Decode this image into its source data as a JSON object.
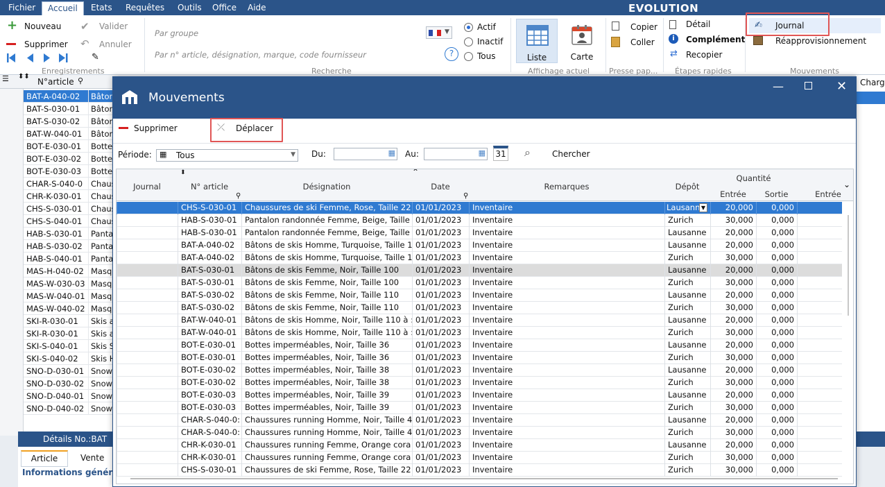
{
  "menubar": {
    "items": [
      "Fichier",
      "Accueil",
      "Etats",
      "Requêtes",
      "Outils",
      "Office",
      "Aide"
    ],
    "app_title": "EVOLUTION"
  },
  "ribbon": {
    "nouveau": "Nouveau",
    "supprimer": "Supprimer",
    "valider": "Valider",
    "annuler": "Annuler",
    "group_enregistrements": "Enregistrements",
    "search_group_placeholder": "Par groupe",
    "search_article_placeholder": "Par n° article, désignation,  marque, code fournisseur",
    "group_recherche": "Recherche",
    "filter_actif": "Actif",
    "filter_inactif": "Inactif",
    "filter_tous": "Tous",
    "view_liste": "Liste",
    "view_carte": "Carte",
    "group_affichage": "Affichage actuel",
    "copier": "Copier",
    "coller": "Coller",
    "group_presse": "Presse pap...",
    "detail": "Détail",
    "complement": "Complément",
    "recopier": "Recopier",
    "group_etapes": "Étapes rapides",
    "journal": "Journal",
    "reappro": "Réapprovisionnement",
    "group_mouvements": "Mouvements"
  },
  "left_grid": {
    "header": "N°article",
    "rows": [
      [
        "BAT-A-040-02",
        "Bâton"
      ],
      [
        "BAT-S-030-01",
        "Bâton"
      ],
      [
        "BAT-S-030-02",
        "Bâton"
      ],
      [
        "BAT-W-040-01",
        "Bâton"
      ],
      [
        "BOT-E-030-01",
        "Bottes"
      ],
      [
        "BOT-E-030-02",
        "Bottes"
      ],
      [
        "BOT-E-030-03",
        "Bottes"
      ],
      [
        "CHAR-S-040-0",
        "Chaus"
      ],
      [
        "CHR-K-030-01",
        "Chaus"
      ],
      [
        "CHS-S-030-01",
        "Chaus"
      ],
      [
        "CHS-S-040-01",
        "Chaus"
      ],
      [
        "HAB-S-030-01",
        "Panta"
      ],
      [
        "HAB-S-030-02",
        "Panta"
      ],
      [
        "HAB-S-040-01",
        "Panta"
      ],
      [
        "MAS-H-040-02",
        "Masqu"
      ],
      [
        "MAS-W-030-03",
        "Masqu"
      ],
      [
        "MAS-W-040-01",
        "Masqu"
      ],
      [
        "MAS-W-040-02",
        "Masqu"
      ],
      [
        "SKI-R-030-01",
        "Skis a"
      ],
      [
        "SKI-R-030-01",
        "Skis a"
      ],
      [
        "SKI-S-040-01",
        "Skis S"
      ],
      [
        "SKI-S-040-02",
        "Skis H"
      ],
      [
        "SNO-D-030-01",
        "Snowl"
      ],
      [
        "SNO-D-030-02",
        "Snowl"
      ],
      [
        "SNO-D-040-01",
        "Snowl"
      ],
      [
        "SNO-D-040-02",
        "Snowl"
      ]
    ],
    "details_label": "Détails No.:BAT",
    "tab_article": "Article",
    "tab_vente": "Vente",
    "info_label": "Informations génér",
    "right_header": "Charg"
  },
  "dialog": {
    "title": "Mouvements",
    "supprimer": "Supprimer",
    "deplacer": "Déplacer",
    "periode_label": "Période:",
    "periode_value": "Tous",
    "du_label": "Du:",
    "au_label": "Au:",
    "calendar_day": "31",
    "chercher": "Chercher",
    "columns": {
      "journal": "Journal",
      "article": "N° article",
      "designation": "Désignation",
      "date": "Date",
      "remarques": "Remarques",
      "depot": "Dépôt",
      "quantite": "Quantité",
      "entree": "Entrée",
      "sortie": "Sortie",
      "entree2": "Entrée"
    },
    "rows": [
      {
        "article": "CHS-S-030-01",
        "designation": "Chaussures de ski Femme, Rose, Taille 22",
        "date": "01/01/2023",
        "remarques": "Inventaire",
        "depot": "Lausanne",
        "entree": "20,000",
        "sortie": "0,000"
      },
      {
        "article": "HAB-S-030-01",
        "designation": "Pantalon randonnée Femme, Beige, Taille",
        "date": "01/01/2023",
        "remarques": "Inventaire",
        "depot": "Zurich",
        "entree": "30,000",
        "sortie": "0,000"
      },
      {
        "article": "HAB-S-030-01",
        "designation": "Pantalon randonnée Femme, Beige, Taille",
        "date": "01/01/2023",
        "remarques": "Inventaire",
        "depot": "Lausanne",
        "entree": "20,000",
        "sortie": "0,000"
      },
      {
        "article": "BAT-A-040-02",
        "designation": "Bâtons de skis Homme, Turquoise, Taille 1",
        "date": "01/01/2023",
        "remarques": "Inventaire",
        "depot": "Lausanne",
        "entree": "20,000",
        "sortie": "0,000"
      },
      {
        "article": "BAT-A-040-02",
        "designation": "Bâtons de skis Homme, Turquoise, Taille 1",
        "date": "01/01/2023",
        "remarques": "Inventaire",
        "depot": "Zurich",
        "entree": "30,000",
        "sortie": "0,000"
      },
      {
        "article": "BAT-S-030-01",
        "designation": "Bâtons de skis Femme, Noir, Taille 100",
        "date": "01/01/2023",
        "remarques": "Inventaire",
        "depot": "Lausanne",
        "entree": "20,000",
        "sortie": "0,000"
      },
      {
        "article": "BAT-S-030-01",
        "designation": "Bâtons de skis Femme, Noir, Taille 100",
        "date": "01/01/2023",
        "remarques": "Inventaire",
        "depot": "Zurich",
        "entree": "30,000",
        "sortie": "0,000"
      },
      {
        "article": "BAT-S-030-02",
        "designation": "Bâtons de skis Femme, Noir, Taille 110",
        "date": "01/01/2023",
        "remarques": "Inventaire",
        "depot": "Lausanne",
        "entree": "20,000",
        "sortie": "0,000"
      },
      {
        "article": "BAT-S-030-02",
        "designation": "Bâtons de skis Femme, Noir, Taille 110",
        "date": "01/01/2023",
        "remarques": "Inventaire",
        "depot": "Zurich",
        "entree": "30,000",
        "sortie": "0,000"
      },
      {
        "article": "BAT-W-040-01",
        "designation": "Bâtons de skis Homme, Noir, Taille 110 à :",
        "date": "01/01/2023",
        "remarques": "Inventaire",
        "depot": "Lausanne",
        "entree": "20,000",
        "sortie": "0,000"
      },
      {
        "article": "BAT-W-040-01",
        "designation": "Bâtons de skis Homme, Noir, Taille 110 à :",
        "date": "01/01/2023",
        "remarques": "Inventaire",
        "depot": "Zurich",
        "entree": "30,000",
        "sortie": "0,000"
      },
      {
        "article": "BOT-E-030-01",
        "designation": "Bottes imperméables, Noir, Taille 36",
        "date": "01/01/2023",
        "remarques": "Inventaire",
        "depot": "Lausanne",
        "entree": "20,000",
        "sortie": "0,000"
      },
      {
        "article": "BOT-E-030-01",
        "designation": "Bottes imperméables, Noir, Taille 36",
        "date": "01/01/2023",
        "remarques": "Inventaire",
        "depot": "Zurich",
        "entree": "30,000",
        "sortie": "0,000"
      },
      {
        "article": "BOT-E-030-02",
        "designation": "Bottes imperméables, Noir, Taille 38",
        "date": "01/01/2023",
        "remarques": "Inventaire",
        "depot": "Lausanne",
        "entree": "20,000",
        "sortie": "0,000"
      },
      {
        "article": "BOT-E-030-02",
        "designation": "Bottes imperméables, Noir, Taille 38",
        "date": "01/01/2023",
        "remarques": "Inventaire",
        "depot": "Zurich",
        "entree": "30,000",
        "sortie": "0,000"
      },
      {
        "article": "BOT-E-030-03",
        "designation": "Bottes imperméables, Noir, Taille 39",
        "date": "01/01/2023",
        "remarques": "Inventaire",
        "depot": "Lausanne",
        "entree": "20,000",
        "sortie": "0,000"
      },
      {
        "article": "BOT-E-030-03",
        "designation": "Bottes imperméables, Noir, Taille 39",
        "date": "01/01/2023",
        "remarques": "Inventaire",
        "depot": "Zurich",
        "entree": "30,000",
        "sortie": "0,000"
      },
      {
        "article": "CHAR-S-040-0:",
        "designation": "Chaussures running Homme, Noir, Taille 4",
        "date": "01/01/2023",
        "remarques": "Inventaire",
        "depot": "Lausanne",
        "entree": "20,000",
        "sortie": "0,000"
      },
      {
        "article": "CHAR-S-040-0:",
        "designation": "Chaussures running Homme, Noir, Taille 4",
        "date": "01/01/2023",
        "remarques": "Inventaire",
        "depot": "Zurich",
        "entree": "30,000",
        "sortie": "0,000"
      },
      {
        "article": "CHR-K-030-01",
        "designation": "Chaussures running Femme, Orange cora",
        "date": "01/01/2023",
        "remarques": "Inventaire",
        "depot": "Lausanne",
        "entree": "20,000",
        "sortie": "0,000"
      },
      {
        "article": "CHR-K-030-01",
        "designation": "Chaussures running Femme, Orange cora",
        "date": "01/01/2023",
        "remarques": "Inventaire",
        "depot": "Zurich",
        "entree": "30,000",
        "sortie": "0,000"
      },
      {
        "article": "CHS-S-030-01",
        "designation": "Chaussures de ski Femme, Rose, Taille 22",
        "date": "01/01/2023",
        "remarques": "Inventaire",
        "depot": "Zurich",
        "entree": "30,000",
        "sortie": "0,000"
      }
    ]
  },
  "colors": {
    "brand": "#2b5489",
    "selection": "#2f7ad1",
    "highlight_box": "#e05555"
  }
}
